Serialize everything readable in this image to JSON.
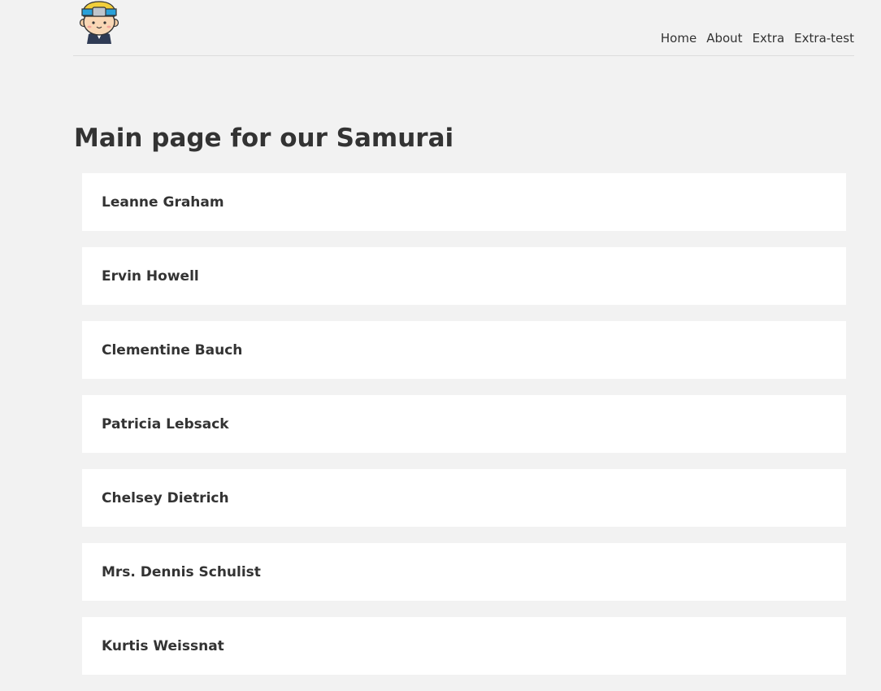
{
  "brand": {
    "logo_icon": "samurai-avatar-icon"
  },
  "nav": {
    "items": [
      {
        "label": "Home"
      },
      {
        "label": "About"
      },
      {
        "label": "Extra"
      },
      {
        "label": "Extra-test"
      }
    ]
  },
  "main": {
    "title": "Main page for our Samurai",
    "users": [
      {
        "name": "Leanne Graham"
      },
      {
        "name": "Ervin Howell"
      },
      {
        "name": "Clementine Bauch"
      },
      {
        "name": "Patricia Lebsack"
      },
      {
        "name": "Chelsey Dietrich"
      },
      {
        "name": "Mrs. Dennis Schulist"
      },
      {
        "name": "Kurtis Weissnat"
      }
    ]
  },
  "colors": {
    "background": "#f2f2f2",
    "card": "#ffffff",
    "text": "#333333",
    "headband_yellow": "#f2cf3b",
    "headband_blue": "#2aa0d8"
  }
}
